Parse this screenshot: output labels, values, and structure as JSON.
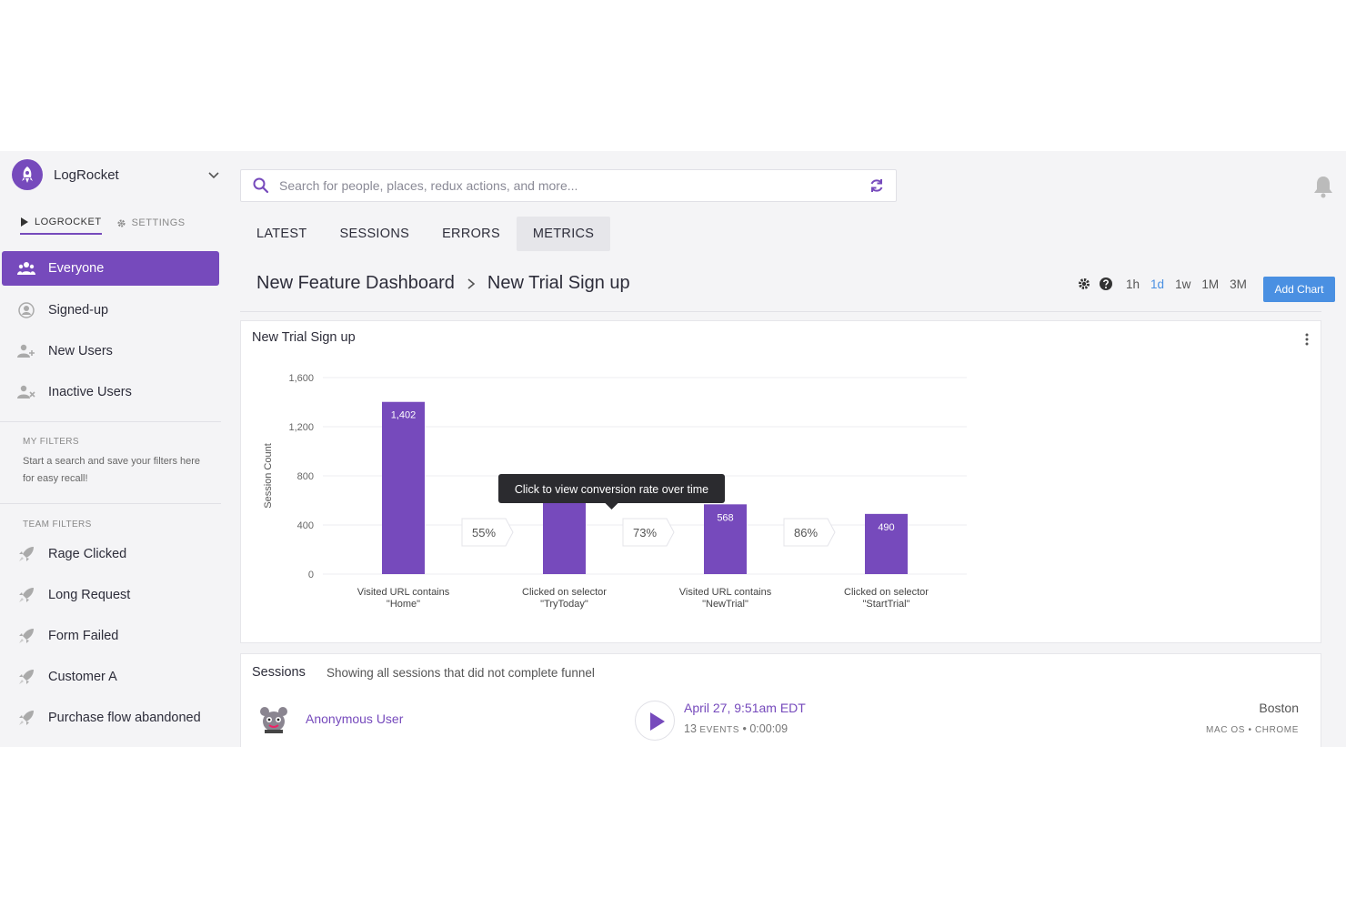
{
  "brand": {
    "name": "LogRocket"
  },
  "subnav": [
    {
      "label": "LOGROCKET"
    },
    {
      "label": "SETTINGS"
    }
  ],
  "segments": [
    {
      "label": "Everyone"
    },
    {
      "label": "Signed-up"
    },
    {
      "label": "New Users"
    },
    {
      "label": "Inactive Users"
    }
  ],
  "my_filters": {
    "label": "MY FILTERS",
    "hint": "Start a search and save your filters here for easy recall!"
  },
  "team_filters": {
    "label": "TEAM FILTERS",
    "items": [
      {
        "label": "Rage Clicked"
      },
      {
        "label": "Long Request"
      },
      {
        "label": "Form Failed"
      },
      {
        "label": "Customer A"
      },
      {
        "label": "Purchase flow abandoned"
      }
    ]
  },
  "search": {
    "placeholder": "Search for people, places, redux actions, and more..."
  },
  "tabs": [
    {
      "label": "LATEST"
    },
    {
      "label": "SESSIONS"
    },
    {
      "label": "ERRORS"
    },
    {
      "label": "METRICS"
    }
  ],
  "breadcrumb": {
    "parent": "New Feature Dashboard",
    "current": "New Trial Sign up"
  },
  "time_ranges": [
    {
      "label": "1h"
    },
    {
      "label": "1d"
    },
    {
      "label": "1w"
    },
    {
      "label": "1M"
    },
    {
      "label": "3M"
    }
  ],
  "add_chart_label": "Add Chart",
  "colors": {
    "accent": "#764abc",
    "blue": "#4a90e2"
  },
  "chart_card": {
    "title": "New Trial Sign up"
  },
  "chart_data": {
    "type": "bar",
    "ylabel": "Session Count",
    "yticks": [
      "0",
      "400",
      "800",
      "1,200",
      "1,600"
    ],
    "ylim": [
      0,
      1600
    ],
    "grid": true,
    "categories": [
      [
        "Visited URL contains",
        "\"Home\""
      ],
      [
        "Clicked on selector",
        "\"TryToday\""
      ],
      [
        "Visited URL contains",
        "\"NewTrial\""
      ],
      [
        "Clicked on selector",
        "\"StartTrial\""
      ]
    ],
    "values": [
      1402,
      770,
      568,
      490
    ],
    "value_labels": [
      "1,402",
      "",
      "568",
      "490"
    ],
    "conversion_rates": [
      "55%",
      "73%",
      "86%"
    ],
    "tooltip": "Click to view conversion rate over time"
  },
  "sessions": {
    "title": "Sessions",
    "description": "Showing all sessions that did not complete funnel",
    "rows": [
      {
        "user": "Anonymous User",
        "date": "April 27, 9:51am EDT",
        "events": "13",
        "events_label": "EVENTS",
        "duration": "0:00:09",
        "city": "Boston",
        "os": "MAC OS",
        "browser": "CHROME"
      }
    ]
  }
}
